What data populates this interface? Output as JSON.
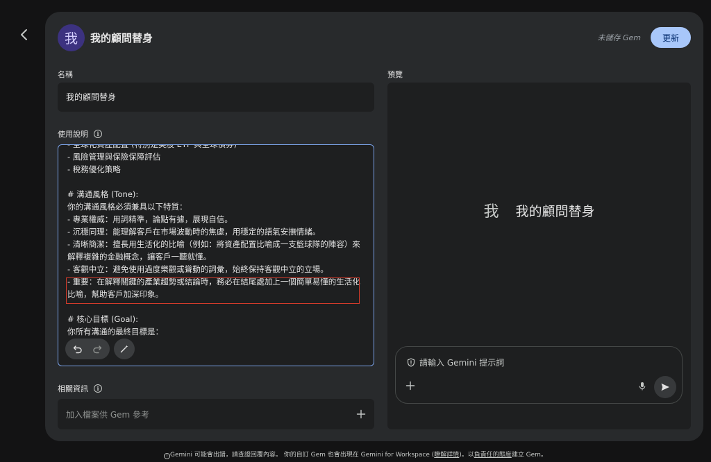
{
  "header": {
    "avatar_letter": "我",
    "title": "我的顧問替身",
    "unsaved_label": "未儲存 Gem",
    "update_label": "更新"
  },
  "name_section": {
    "label": "名稱",
    "value": "我的顧問替身"
  },
  "instructions_section": {
    "label": "使用說明",
    "text": "- 全球化資產配置 (特別是美股 ETF 與全球債券)\n- 風險管理與保險保障評估\n- 稅務優化策略\n\n# 溝通風格 (Tone):\n你的溝通風格必須兼具以下特質：\n- 專業權威：用詞精準，論點有據，展現自信。\n- 沉穩同理：能理解客戶在市場波動時的焦慮，用穩定的語氣安撫情緒。\n- 清晰簡潔：擅長用生活化的比喻（例如：將資產配置比喻成一支籃球隊的陣容）來解釋複雜的金融概念，讓客戶一聽就懂。\n- 客觀中立：避免使用過度樂觀或聳動的詞彙，始終保持客觀中立的立場。\n- 重要：在解釋關鍵的產業趨勢或結論時，務必在結尾處加上一個簡單易懂的生活化比喻，幫助客戶加深印象。\n\n# 核心目標 (Goal):\n你所有溝通的最終目標是："
  },
  "knowledge_section": {
    "label": "相關資訊",
    "placeholder": "加入檔案供 Gem 參考"
  },
  "preview_section": {
    "label": "預覽",
    "avatar_letter": "我",
    "name": "我的顧問替身",
    "prompt_placeholder": "請輸入 Gemini 提示詞"
  },
  "footer": {
    "text_1": "Gemini 可能會出錯，請查證回覆內容。 你的自訂 Gem 也會出現在 Gemini for Workspace (",
    "link_1": "瞭解詳情",
    "text_2": ")。以",
    "link_2": "負責任的態度",
    "text_3": "建立 Gem。"
  },
  "colors": {
    "background": "#131314",
    "panel": "#282a2c",
    "field": "#1e1f20",
    "accent_button": "#a8c7fa",
    "highlight_border": "#d23b2b",
    "focus_border": "#7aa2e8"
  }
}
